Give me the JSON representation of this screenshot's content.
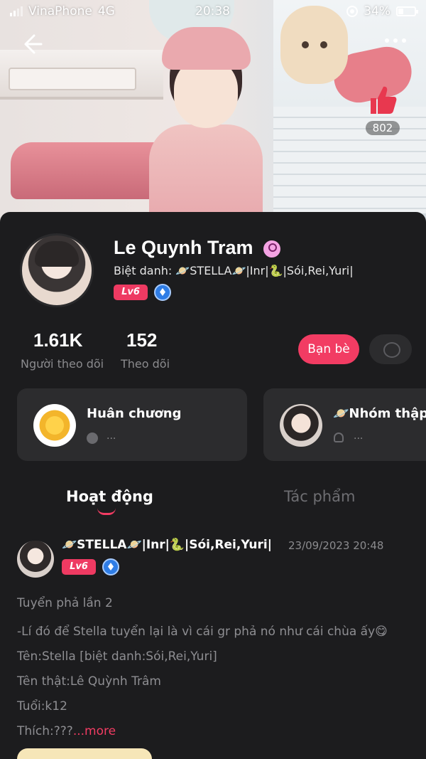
{
  "status_bar": {
    "carrier": "VinaPhone",
    "network": "4G",
    "time": "20:38",
    "battery_percent": "34%",
    "battery_level": 0.34
  },
  "header": {
    "like_count": "802"
  },
  "profile": {
    "name": "Le Quynh Tram",
    "nickname_line": "Biệt danh: 🪐STELLA🪐|Inr|🐍|Sói,Rei,Yuri|",
    "level": "Lv6",
    "followers_count": "1.61K",
    "followers_label": "Người theo dõi",
    "following_count": "152",
    "following_label": "Theo dõi",
    "friend_button": "Bạn bè"
  },
  "cards": [
    {
      "title": "Huân chương",
      "sub": "..."
    },
    {
      "title": "🪐Nhóm thập",
      "sub": "..."
    }
  ],
  "tabs": [
    {
      "label": "Hoạt động",
      "active": true
    },
    {
      "label": "Tác phẩm",
      "active": false
    }
  ],
  "post": {
    "author": "🪐STELLA🪐|Inr|🐍|Sói,Rei,Yuri|",
    "timestamp": "23/09/2023 20:48",
    "level": "Lv6",
    "lines": [
      "Tuyển phả lần 2",
      "-Lí đó để Stella tuyển lại là vì cái gr phả nó như cái chùa ấy😋",
      "Tên:Stella [biệt danh:Sói,Rei,Yuri]",
      "Tên thật:Lê Quỳnh Trâm",
      "Tuổi:k12",
      "Thích:???"
    ],
    "more_label": "...more"
  },
  "colors": {
    "accent": "#f23c63",
    "background": "#1c1c1e",
    "card": "#2c2c2e",
    "muted_text": "#8b8b8e"
  },
  "icons": {
    "back": "arrow-left-icon",
    "more": "more-dots-icon",
    "like": "thumbs-up-icon",
    "verified": "gem-badge-icon",
    "chat": "chat-bubble-icon"
  }
}
